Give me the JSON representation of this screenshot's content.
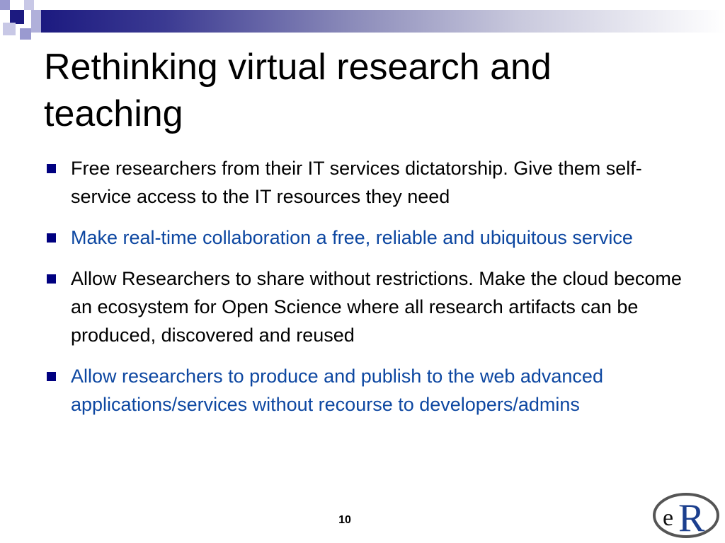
{
  "slide": {
    "title": "Rethinking virtual research and teaching",
    "bullets": [
      {
        "text": "Free researchers from their IT services dictatorship. Give them self-service access to the IT resources they need",
        "color": "#000000"
      },
      {
        "text": "Make real-time collaboration a free, reliable and ubiquitous service",
        "color": "#0d47a1"
      },
      {
        "text": "Allow Researchers to share without restrictions. Make the cloud become an ecosystem for Open Science where all research artifacts can be produced, discovered and reused",
        "color": "#000000"
      },
      {
        "text": "Allow researchers to produce and publish to the web advanced applications/services without recourse to developers/admins",
        "color": "#0d47a1"
      }
    ],
    "page_number": "10",
    "logo": {
      "text_e": "e",
      "text_r": "R"
    }
  },
  "colors": {
    "accent": "#1c1a80",
    "bullet_marker": "#000080",
    "blue_text": "#0d47a1"
  }
}
